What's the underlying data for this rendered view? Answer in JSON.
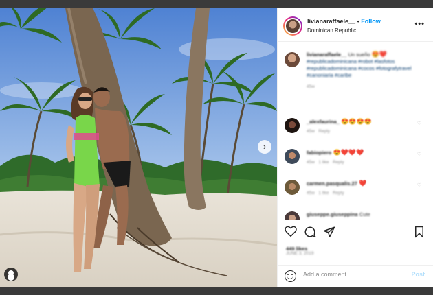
{
  "post": {
    "username": "livianaraffaele__",
    "follow_label": "Follow",
    "location": "Dominican Republic",
    "caption_username": "livianaraffaele__",
    "caption_text": "Un sueño",
    "caption_tags": "#republicadominicana #robot #lasfotos #republicadominicana #cocos #fotografytravel #canoniaria #caribe",
    "caption_age": "45w"
  },
  "comments": [
    {
      "username": "_alexfaurina_",
      "emojis": "😍😍😍😍",
      "age": "45w",
      "action": "Reply"
    },
    {
      "username": "fabiopiero",
      "emojis": "😍❤️❤️❤️",
      "age": "45w",
      "likes": "1 like",
      "action": "Reply"
    },
    {
      "username": "carmen.pasqualis.27",
      "emojis": "❤️",
      "age": "45w",
      "likes": "1 like",
      "action": "Reply"
    },
    {
      "username": "giuseppe.giuseppina",
      "text": "Cute"
    }
  ],
  "actions": {
    "likes_text": "449 likes",
    "date_text": "JUNE 3, 2019"
  },
  "add_comment": {
    "placeholder": "Add a comment...",
    "post_label": "Post"
  },
  "colors": {
    "accent": "#0095f6",
    "post_disabled": "#b2dffc",
    "background": "#3a3a3a"
  }
}
